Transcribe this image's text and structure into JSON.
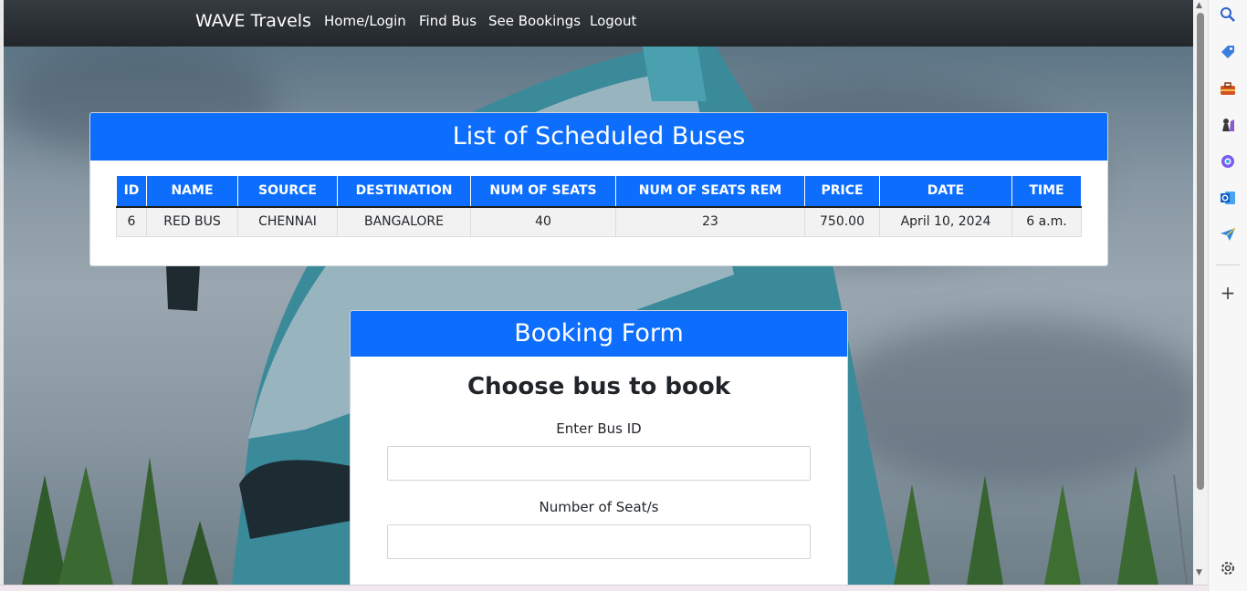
{
  "navbar": {
    "brand": "WAVE Travels",
    "links": [
      "Home/Login",
      "Find Bus",
      "See Bookings",
      "Logout"
    ]
  },
  "bus_list": {
    "title": "List of Scheduled Buses",
    "columns": [
      "ID",
      "NAME",
      "SOURCE",
      "DESTINATION",
      "NUM OF SEATS",
      "NUM OF SEATS REM",
      "PRICE",
      "DATE",
      "TIME"
    ],
    "rows": [
      [
        "6",
        "RED BUS",
        "CHENNAI",
        "BANGALORE",
        "40",
        "23",
        "750.00",
        "April 10, 2024",
        "6 a.m."
      ]
    ]
  },
  "booking_form": {
    "title": "Booking Form",
    "heading": "Choose bus to book",
    "bus_id_label": "Enter Bus ID",
    "bus_id_value": "",
    "seats_label": "Number of Seat/s",
    "seats_value": ""
  },
  "browser_sidebar": {
    "icons": [
      "search-icon",
      "tag-icon",
      "toolbox-icon",
      "chess-icon",
      "copilot-icon",
      "outlook-icon",
      "send-icon",
      "plus-icon",
      "settings-icon"
    ]
  },
  "colors": {
    "primary": "#0d6efd",
    "navbar": "#2b3035"
  }
}
